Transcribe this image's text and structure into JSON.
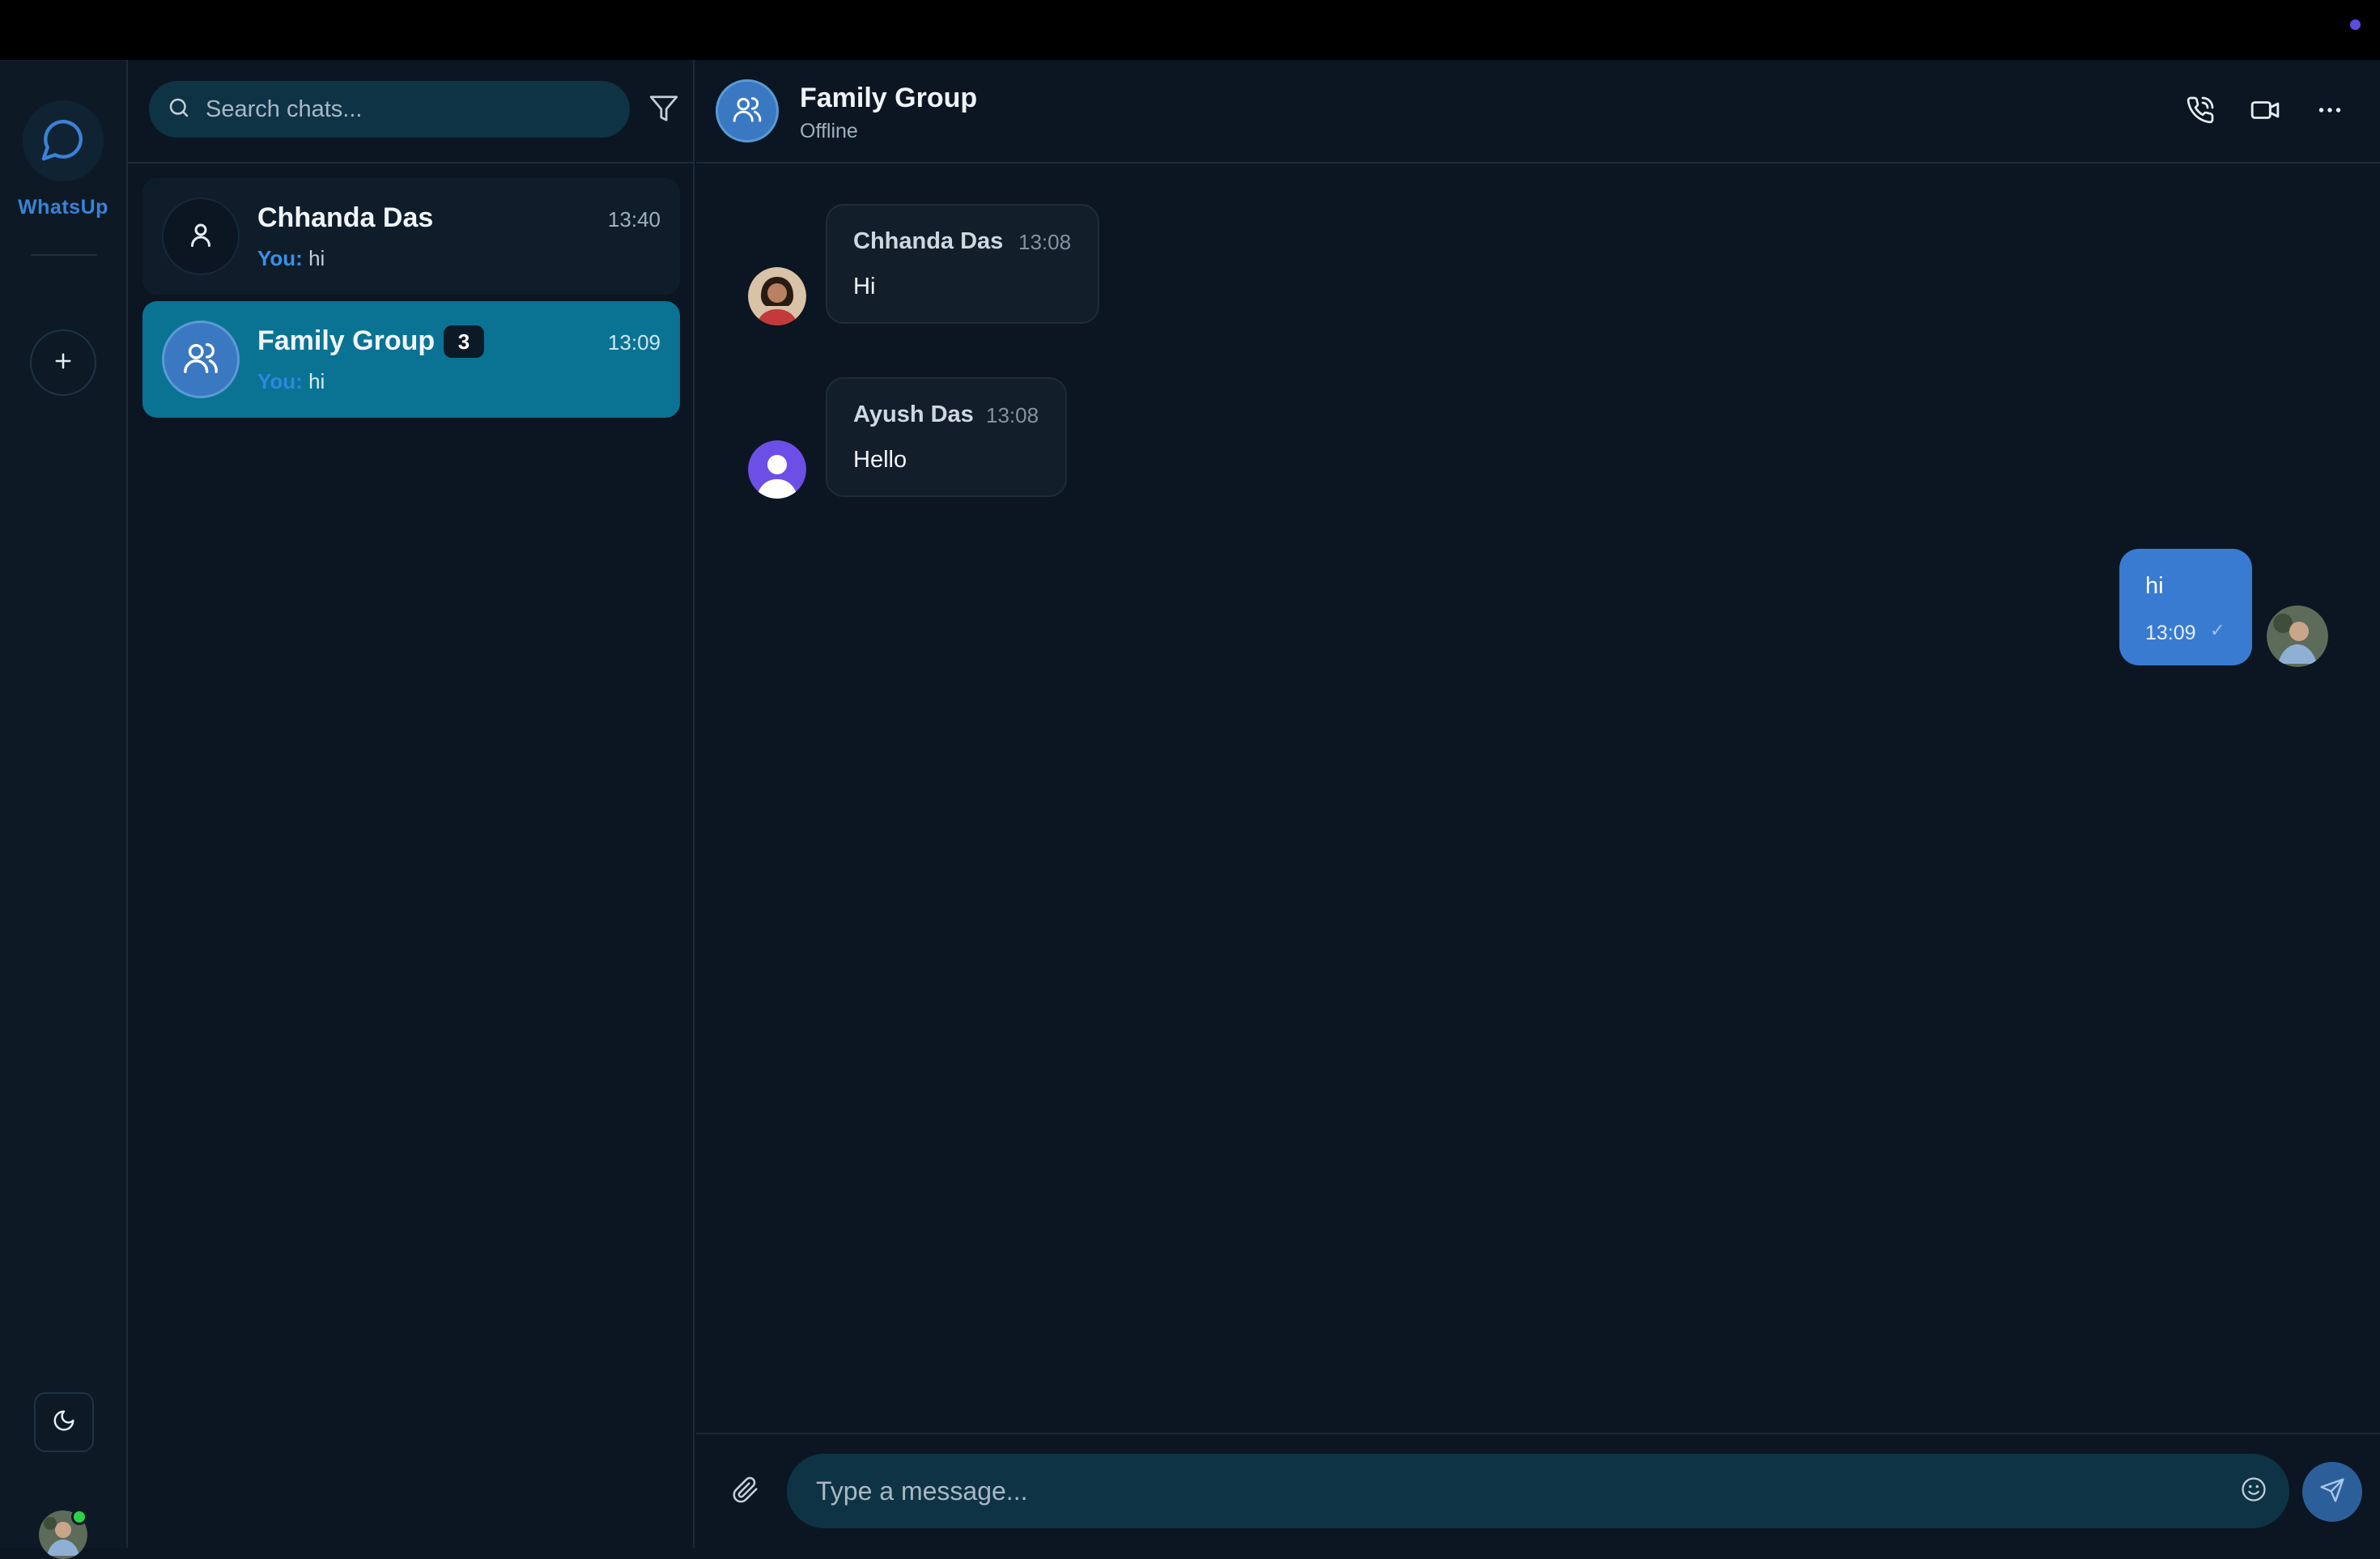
{
  "app": {
    "name": "WhatsUp"
  },
  "search": {
    "placeholder": "Search chats..."
  },
  "chats": [
    {
      "name": "Chhanda Das",
      "time": "13:40",
      "preview_prefix": "You:",
      "preview_text": "hi",
      "unread": ""
    },
    {
      "name": "Family Group",
      "time": "13:09",
      "preview_prefix": "You:",
      "preview_text": "hi",
      "unread": "3",
      "active": true
    }
  ],
  "conversation": {
    "title": "Family Group",
    "status": "Offline",
    "messages": [
      {
        "sender": "Chhanda Das",
        "time": "13:08",
        "text": "Hi",
        "incoming": true
      },
      {
        "sender": "Ayush Das",
        "time": "13:08",
        "text": "Hello",
        "incoming": true
      },
      {
        "sender": "",
        "time": "13:09",
        "text": "hi",
        "incoming": false,
        "tick": "✓"
      }
    ]
  },
  "composer": {
    "placeholder": "Type a message..."
  },
  "colors": {
    "accent": "#3a7bd2",
    "active_chat": "#0a7394",
    "online": "#2bd14a",
    "brand_text": "#3b82d6"
  },
  "icons": [
    "chat-bubble-icon",
    "plus-icon",
    "moon-icon",
    "search-icon",
    "filter-icon",
    "user-icon",
    "users-icon",
    "phone-icon",
    "video-icon",
    "more-icon",
    "paperclip-icon",
    "smile-icon",
    "send-icon"
  ]
}
